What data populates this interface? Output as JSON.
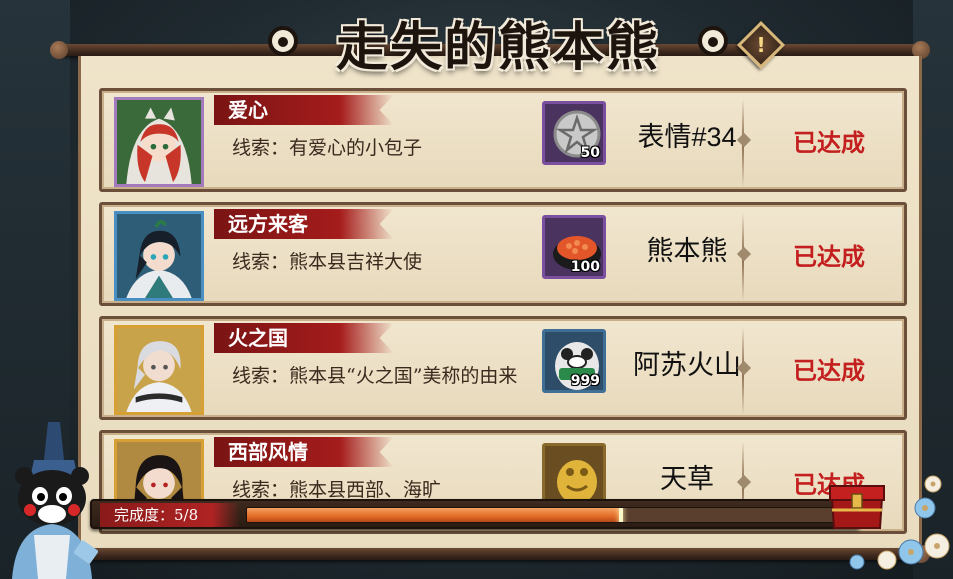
{
  "header": {
    "title": "走失的熊本熊",
    "info_icon": "info-diamond-icon",
    "info_label": "!"
  },
  "quests": [
    {
      "name": "爱心",
      "clue": "线索：有爱心的小包子",
      "reward_icon": "silver-medal-icon",
      "reward_qty": "50",
      "reward_name": "表情#34",
      "status": "已达成",
      "portrait_frame": "#a37bbd"
    },
    {
      "name": "远方来客",
      "clue": "线索：熊本县吉祥大使",
      "reward_icon": "sushi-icon",
      "reward_qty": "100",
      "reward_name": "熊本熊",
      "status": "已达成",
      "portrait_frame": "#4a8fc2"
    },
    {
      "name": "火之国",
      "clue": "线索：熊本县“火之国”美称的由来",
      "reward_icon": "material-daruma-icon",
      "reward_qty": "999",
      "reward_name": "阿苏火山",
      "status": "已达成",
      "portrait_frame": "#d7a035"
    },
    {
      "name": "西部风情",
      "clue": "线索：熊本县西部、海旷",
      "reward_icon": "gold-daruma-icon",
      "reward_qty": "",
      "reward_name": "天草",
      "status": "已达成",
      "portrait_frame": "#d7a035"
    }
  ],
  "progress": {
    "label": "完成度：5/8",
    "completed": 5,
    "total": 8
  },
  "colors": {
    "status_red": "#c41f1f",
    "progress_orange": "#e26a25",
    "banner_red": "#a51c1c"
  }
}
